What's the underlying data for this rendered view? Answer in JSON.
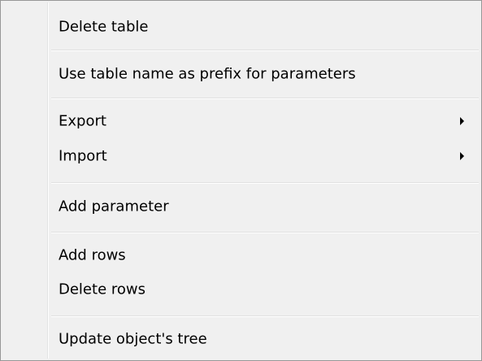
{
  "menu": {
    "items": [
      {
        "label": "Delete table"
      },
      {
        "label": "Use table name as prefix for parameters"
      },
      {
        "label": "Export",
        "arrow_icon": "submenu-arrow-icon"
      },
      {
        "label": "Import",
        "arrow_icon": "submenu-arrow-icon"
      },
      {
        "label": "Add parameter"
      },
      {
        "label": "Add rows"
      },
      {
        "label": "Delete rows"
      },
      {
        "label": "Update object's tree"
      }
    ]
  },
  "colors": {
    "background": "#f0f0f0",
    "border": "#979797",
    "separator": "#e0e0e0",
    "text": "#000000"
  }
}
